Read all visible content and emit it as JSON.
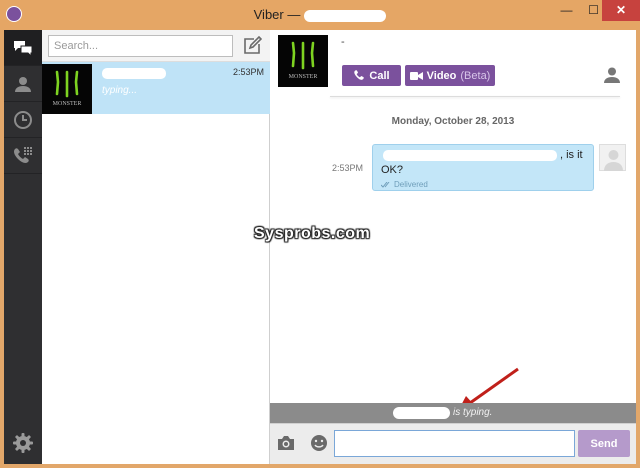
{
  "window": {
    "title": "Viber —",
    "minimize_glyph": "—",
    "maximize_glyph": "☐",
    "close_glyph": "✕"
  },
  "rail": {
    "items": [
      {
        "icon": "chats-icon",
        "active": true
      },
      {
        "icon": "contacts-icon",
        "active": false
      },
      {
        "icon": "recents-icon",
        "active": false
      },
      {
        "icon": "dialpad-icon",
        "active": false
      }
    ],
    "settings_icon": "gear-icon"
  },
  "sidebar": {
    "search_placeholder": "Search...",
    "conversations": [
      {
        "time": "2:53PM",
        "status": "typing...",
        "avatar_text": "MONSTER",
        "selected": true
      }
    ]
  },
  "chat": {
    "contact_name": "-",
    "avatar_text": "MONSTER",
    "call_label": "Call",
    "video_label": "Video",
    "video_beta": "(Beta)",
    "date_separator": "Monday, October 28, 2013",
    "messages": [
      {
        "time": "2:53PM",
        "text_line1": ", is it",
        "text_line2": "OK?",
        "status": "Delivered"
      }
    ],
    "typing_suffix": "is typing.",
    "send_label": "Send",
    "input_value": ""
  },
  "watermark": "Sysprobs.com",
  "colors": {
    "viber_purple": "#7b519d",
    "send_disabled": "#b59acb",
    "selected_row": "#bfe3f7",
    "bubble": "#c3e6f8",
    "rail_bg": "#2f2f31",
    "typing_bar": "#8b8b8b",
    "window_frame": "#e5a665",
    "close_red": "#c7423e",
    "annotation_arrow": "#c0201a"
  }
}
